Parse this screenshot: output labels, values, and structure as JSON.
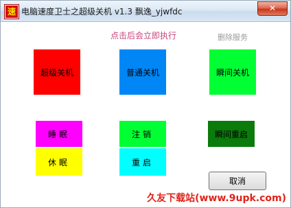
{
  "window": {
    "title": "电脑速度卫士之超级关机  v1.3 飘逸_yjwfdc",
    "icon_glyph": "速",
    "close_glyph": "✕"
  },
  "hint_text": "点击后会立即执行",
  "remove_service_label": "删除服务",
  "buttons": {
    "super_shutdown": "超级关机",
    "normal_shutdown": "普通关机",
    "instant_shutdown": "瞬间关机",
    "sleep": "睡眠",
    "hibernate": "休眠",
    "logoff": "注销",
    "restart": "重启",
    "instant_restart": "瞬间重启",
    "cancel": "取消"
  },
  "watermark": "久友下载站(www.9upk.com)",
  "colors": {
    "super_shutdown": "#ff0000",
    "normal_shutdown": "#0087f5",
    "instant_shutdown": "#00ff33",
    "sleep": "#ff00ff",
    "hibernate": "#ffff00",
    "logoff": "#00ff33",
    "restart": "#00ffff",
    "instant_restart": "#0b7b0b",
    "hint_text": "#c8437c",
    "watermark": "#e0221a"
  }
}
